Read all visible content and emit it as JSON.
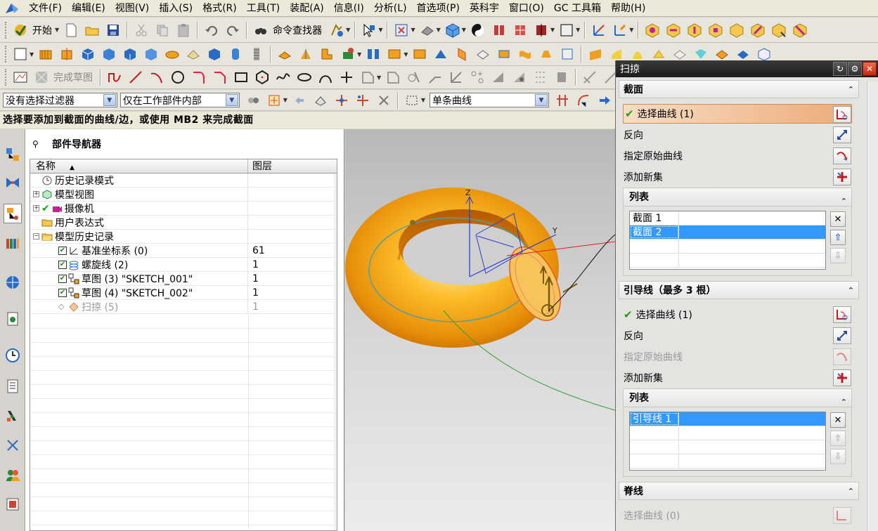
{
  "menu": [
    "文件(F)",
    "编辑(E)",
    "视图(V)",
    "插入(S)",
    "格式(R)",
    "工具(T)",
    "装配(A)",
    "信息(I)",
    "分析(L)",
    "首选项(P)",
    "英科宇",
    "窗口(O)",
    "GC 工具箱",
    "帮助(H)"
  ],
  "toolbar": {
    "start_label": "开始",
    "command_finder_label": "命令查找器",
    "finish_sketch_label": "完成草图"
  },
  "selection_bar": {
    "filter": "没有选择过滤器",
    "scope": "仅在工作部件内部",
    "curve_rule": "单条曲线"
  },
  "status": "选择要添加到截面的曲线/边，或使用 MB2 来完成截面",
  "navigator": {
    "title": "部件导航器",
    "col_name": "名称",
    "col_layer": "图层",
    "rows": [
      {
        "label": "历史记录模式",
        "layer": ""
      },
      {
        "label": "模型视图",
        "layer": ""
      },
      {
        "label": "摄像机",
        "layer": ""
      },
      {
        "label": "用户表达式",
        "layer": ""
      },
      {
        "label": "模型历史记录",
        "layer": ""
      },
      {
        "label": "基准坐标系 (0)",
        "layer": "61"
      },
      {
        "label": "螺旋线 (2)",
        "layer": "1"
      },
      {
        "label": "草图 (3) \"SKETCH_001\"",
        "layer": "1"
      },
      {
        "label": "草图 (4) \"SKETCH_002\"",
        "layer": "1"
      },
      {
        "label": "扫掠 (5)",
        "layer": "1"
      }
    ]
  },
  "dialog": {
    "title": "扫掠",
    "section": {
      "header": "截面",
      "select_curve": "选择曲线 (1)",
      "reverse": "反向",
      "specify_origin": "指定原始曲线",
      "add_new_set": "添加新集",
      "list_header": "列表",
      "items": [
        "截面 1",
        "截面 2"
      ]
    },
    "guide": {
      "header": "引导线（最多 3 根）",
      "select_curve": "选择曲线 (1)",
      "reverse": "反向",
      "specify_origin": "指定原始曲线",
      "add_new_set": "添加新集",
      "list_header": "列表",
      "items": [
        "引导线 1"
      ]
    },
    "spine": {
      "header": "脊线",
      "select_curve": "选择曲线 (0)"
    }
  },
  "viewport": {
    "axis_z": "Z",
    "axis_y": "Y"
  },
  "colors": {
    "part_orange": "#f5a81c",
    "selection_blue": "#3399ff",
    "active_row": "#ecab78"
  }
}
